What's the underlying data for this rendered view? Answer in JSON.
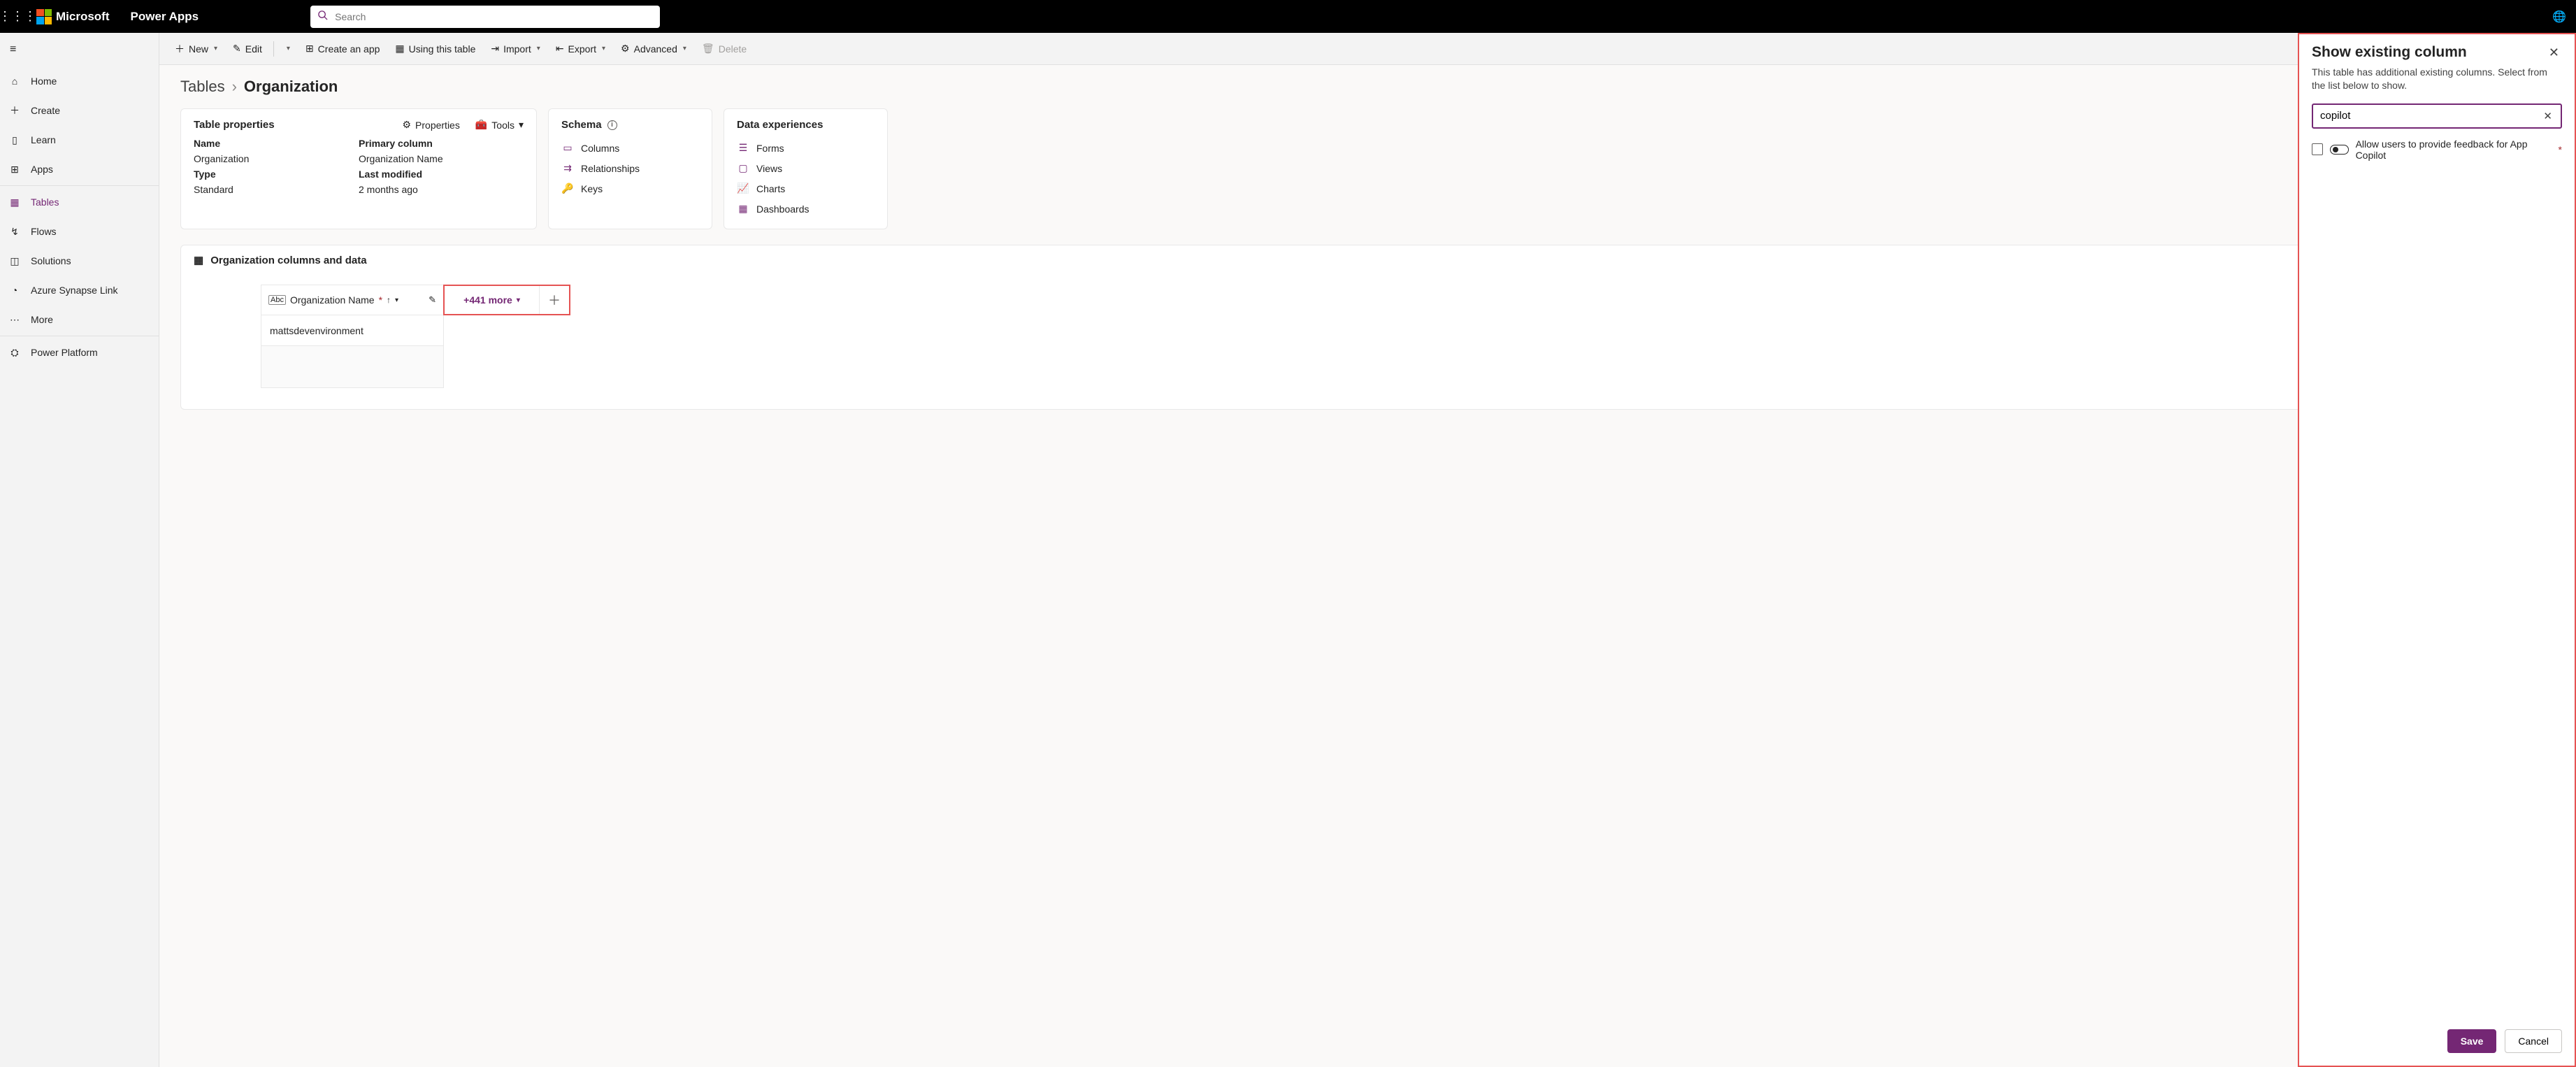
{
  "top": {
    "ms": "Microsoft",
    "app": "Power Apps",
    "search_placeholder": "Search"
  },
  "nav": {
    "home": "Home",
    "create": "Create",
    "learn": "Learn",
    "apps": "Apps",
    "tables": "Tables",
    "flows": "Flows",
    "solutions": "Solutions",
    "synapse": "Azure Synapse Link",
    "more": "More",
    "platform": "Power Platform"
  },
  "cmd": {
    "new": "New",
    "edit": "Edit",
    "create_app": "Create an app",
    "using_table": "Using this table",
    "import": "Import",
    "export": "Export",
    "advanced": "Advanced",
    "delete": "Delete"
  },
  "breadcrumb": {
    "root": "Tables",
    "leaf": "Organization"
  },
  "props_card": {
    "title": "Table properties",
    "properties": "Properties",
    "tools": "Tools",
    "name_lbl": "Name",
    "name_val": "Organization",
    "pc_lbl": "Primary column",
    "pc_val": "Organization Name",
    "type_lbl": "Type",
    "type_val": "Standard",
    "lm_lbl": "Last modified",
    "lm_val": "2 months ago"
  },
  "schema_card": {
    "title": "Schema",
    "columns": "Columns",
    "relationships": "Relationships",
    "keys": "Keys"
  },
  "dxp_card": {
    "title": "Data experiences",
    "forms": "Forms",
    "views": "Views",
    "charts": "Charts",
    "dashboards": "Dashboards"
  },
  "data_panel": {
    "title": "Organization columns and data",
    "col_name": "Organization Name",
    "more": "+441 more",
    "row0": "mattsdevenvironment"
  },
  "flyout": {
    "title": "Show existing column",
    "sub": "This table has additional existing columns. Select from the list below to show.",
    "search_value": "copilot",
    "result": "Allow users to provide feedback for App Copilot",
    "save": "Save",
    "cancel": "Cancel"
  }
}
